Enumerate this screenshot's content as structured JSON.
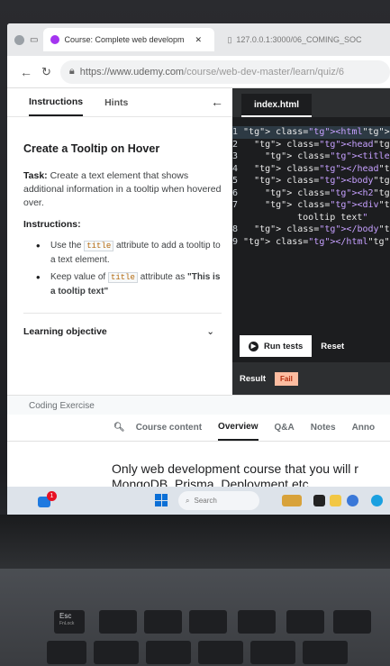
{
  "browser": {
    "active_tab_title": "Course: Complete web developm",
    "inactive_tab_title": "127.0.0.1:3000/06_COMING_SOC",
    "url_main": "https://www.udemy.com",
    "url_path": "/course/web-dev-master/learn/quiz/6"
  },
  "left_panel": {
    "tabs": [
      "Instructions",
      "Hints"
    ],
    "title": "Create a Tooltip on Hover",
    "task_label": "Task:",
    "task_text": " Create a text element that shows additional information in a tooltip when hovered over.",
    "instructions_label": "Instructions:",
    "bullet1_a": "Use the ",
    "bullet1_code": "title",
    "bullet1_b": " attribute to add a tooltip to a text element.",
    "bullet2_a": "Keep value of ",
    "bullet2_code": "title",
    "bullet2_b": " attribute as ",
    "bullet2_value": "\"This is a tooltip text\"",
    "learning_objective": "Learning objective"
  },
  "editor": {
    "file_tab": "index.html",
    "line_numbers": [
      "1",
      "2",
      "3",
      "4",
      "5",
      "6",
      "7",
      "",
      "8",
      "9"
    ],
    "code_lines": [
      "<html>",
      "  <head>",
      "    <title>This is a",
      "  </head>",
      "  <body>",
      "    <h2>example</h2>",
      "    <div title=\"This",
      "      tooltip text\"",
      "  </body>",
      "</html>"
    ],
    "run_label": "Run tests",
    "reset_label": "Reset",
    "result_label": "Result",
    "result_status": "Fail"
  },
  "course": {
    "section_label": "Coding Exercise",
    "nav_tabs": [
      "Course content",
      "Overview",
      "Q&A",
      "Notes",
      "Anno"
    ],
    "promo_line1": "Only web development course that you will r",
    "promo_line2": "MongoDB, Prisma, Deployment etc."
  },
  "taskbar": {
    "search_placeholder": "Search",
    "badge_count": "1"
  },
  "keyboard": {
    "esc": "Esc",
    "fnlock": "FnLock"
  },
  "colors": {
    "editor_bg": "#1c1d1f",
    "fail_bg": "#fcbca0",
    "fail_text": "#b32d0f",
    "code_tag": "#ff6b8a",
    "code_string": "#c6a0ff"
  }
}
